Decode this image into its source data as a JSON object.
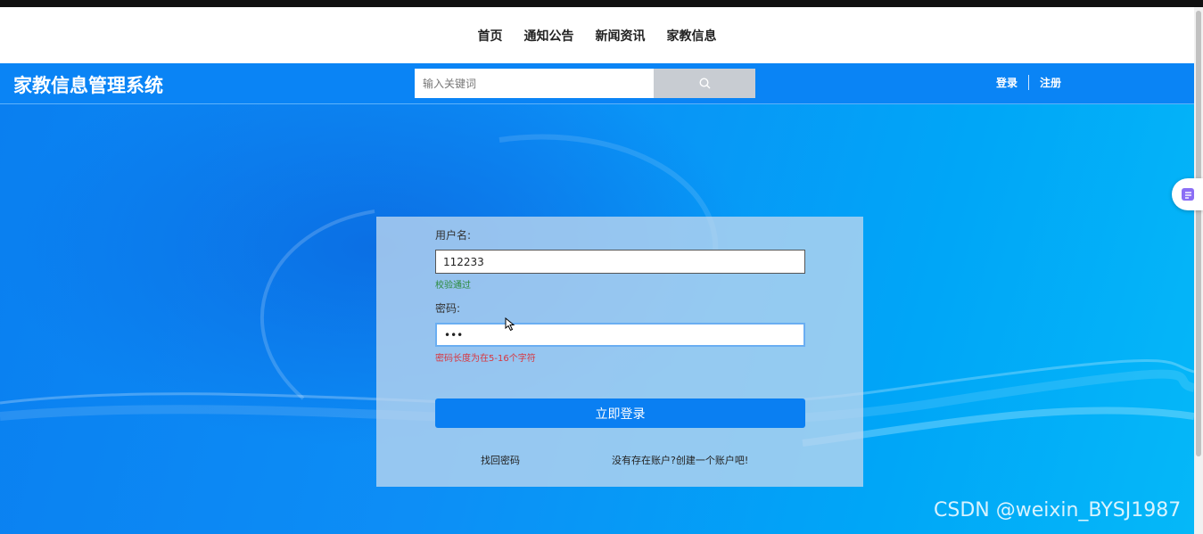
{
  "nav": {
    "items": [
      {
        "label": "首页"
      },
      {
        "label": "通知公告"
      },
      {
        "label": "新闻资讯"
      },
      {
        "label": "家教信息"
      }
    ]
  },
  "header": {
    "site_title": "家教信息管理系统",
    "search_placeholder": "输入关键词",
    "login_label": "登录",
    "register_label": "注册"
  },
  "form": {
    "username_label": "用户名:",
    "username_value": "112233",
    "username_hint": "校验通过",
    "password_label": "密码:",
    "password_value": "•••",
    "password_hint": "密码长度为在5-16个字符",
    "submit_label": "立即登录",
    "forgot_label": "找回密码",
    "register_link_label": "没有存在账户?创建一个账户吧!"
  },
  "watermark": "CSDN @weixin_BYSJ1987",
  "colors": {
    "header_bg": "#0a84f5",
    "button_bg": "#0a7ff2",
    "hint_ok": "#2a8a3a",
    "hint_err": "#d9363e"
  },
  "icons": {
    "search": "search-icon",
    "float": "chat-assistant-icon",
    "cursor": "mouse-cursor-icon"
  }
}
